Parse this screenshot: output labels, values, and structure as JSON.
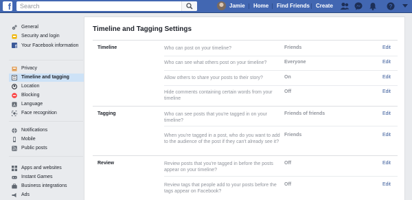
{
  "topbar": {
    "logo": "f",
    "search_placeholder": "Search",
    "user_name": "Jamie",
    "nav": [
      "Home",
      "Find Friends",
      "Create"
    ],
    "icons": [
      "friend-requests-icon",
      "messenger-icon",
      "notifications-icon",
      "help-icon",
      "account-menu-icon"
    ],
    "colors": {
      "bar": "#4267b2",
      "link": "#365899",
      "active_item": "#cde2f7"
    }
  },
  "sidebar": {
    "items": [
      {
        "label": "General",
        "icon": "gear-icon"
      },
      {
        "label": "Security and login",
        "icon": "shield-icon"
      },
      {
        "label": "Your Facebook information",
        "icon": "facebook-icon"
      },
      {
        "label": "Privacy",
        "icon": "lock-icon"
      },
      {
        "label": "Timeline and tagging",
        "icon": "timeline-icon",
        "active": true
      },
      {
        "label": "Location",
        "icon": "location-icon"
      },
      {
        "label": "Blocking",
        "icon": "blocking-icon"
      },
      {
        "label": "Language",
        "icon": "language-icon"
      },
      {
        "label": "Face recognition",
        "icon": "face-recognition-icon"
      },
      {
        "label": "Notifications",
        "icon": "globe-icon"
      },
      {
        "label": "Mobile",
        "icon": "mobile-icon"
      },
      {
        "label": "Public posts",
        "icon": "rss-icon"
      },
      {
        "label": "Apps and websites",
        "icon": "apps-icon"
      },
      {
        "label": "Instant Games",
        "icon": "games-icon"
      },
      {
        "label": "Business integrations",
        "icon": "business-icon"
      },
      {
        "label": "Ads",
        "icon": "ads-icon"
      }
    ]
  },
  "main": {
    "title": "Timeline and Tagging Settings",
    "sections": [
      {
        "name": "Timeline",
        "rows": [
          {
            "question": "Who can post on your timeline?",
            "value": "Friends",
            "action": "Edit"
          },
          {
            "question": "Who can see what others post on your timeline?",
            "value": "Everyone",
            "action": "Edit"
          },
          {
            "question": "Allow others to share your posts to their story?",
            "value": "On",
            "action": "Edit"
          },
          {
            "question": "Hide comments containing certain words from your timeline",
            "value": "Off",
            "action": "Edit"
          }
        ]
      },
      {
        "name": "Tagging",
        "rows": [
          {
            "question": "Who can see posts that you're tagged in on your timeline?",
            "value": "Friends of friends",
            "action": "Edit"
          },
          {
            "question": "When you're tagged in a post, who do you want to add to the audience of the post if they can't already see it?",
            "value": "Friends",
            "action": "Edit"
          }
        ]
      },
      {
        "name": "Review",
        "rows": [
          {
            "question": "Review posts that you're tagged in before the posts appear on your timeline?",
            "value": "Off",
            "action": "Edit"
          },
          {
            "question": "Review tags that people add to your posts before the tags appear on Facebook?",
            "value": "Off",
            "action": "Edit"
          }
        ]
      }
    ]
  }
}
